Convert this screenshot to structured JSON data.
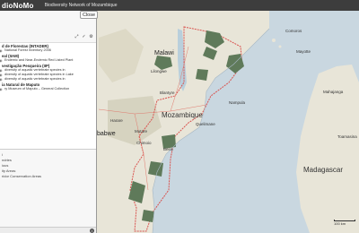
{
  "header": {
    "brand": "dioNoMo",
    "subtitle": "Biodiversity Network of Mozambique"
  },
  "panel": {
    "close_label": "Close",
    "groups": [
      {
        "title": "d de Florestas (INTADER)",
        "layers": [
          "National Forest Inventory 2006"
        ]
      },
      {
        "title": "eal (IIAM)",
        "layers": [
          "Endemic and Near-Endemic Red Listed Plant"
        ]
      },
      {
        "title": "vestigação Pesqueira (IIP)",
        "layers": [
          "diversity of aquatic vertebrate species in",
          "diversity of aquatic vertebrate species in Lake",
          "diversity of aquatic vertebrate species in"
        ]
      },
      {
        "title": "ia Natural de Maputo",
        "layers": [
          "ry Museum of Maputo – General Collection"
        ]
      }
    ],
    "lower_items": [
      "i",
      "ndries",
      "ious",
      "",
      "ity Areas",
      "ridor Conservation Areas"
    ]
  },
  "map_labels": {
    "malawi": "Malawi",
    "mozambique": "Mozambique",
    "madagascar": "Madagascar",
    "comoros": "Comoros",
    "mayotte": "Mayotte",
    "harare": "Harare",
    "mutare": "Mutare",
    "nampula": "Nampula",
    "lilongwe": "Lilongwe",
    "blantyre": "Blantyre",
    "quelimane": "Quelimane",
    "chimoio": "Chimoio",
    "beira": "Beira",
    "abwe": "babwe",
    "mahajanga": "Mahajanga",
    "toamasina": "Toamasina"
  },
  "scale": "100 km",
  "colors": {
    "header": "#3d3d3d",
    "protected_area": "#5f7a5a",
    "border": "#d9534f",
    "water": "#c7d7e3"
  }
}
